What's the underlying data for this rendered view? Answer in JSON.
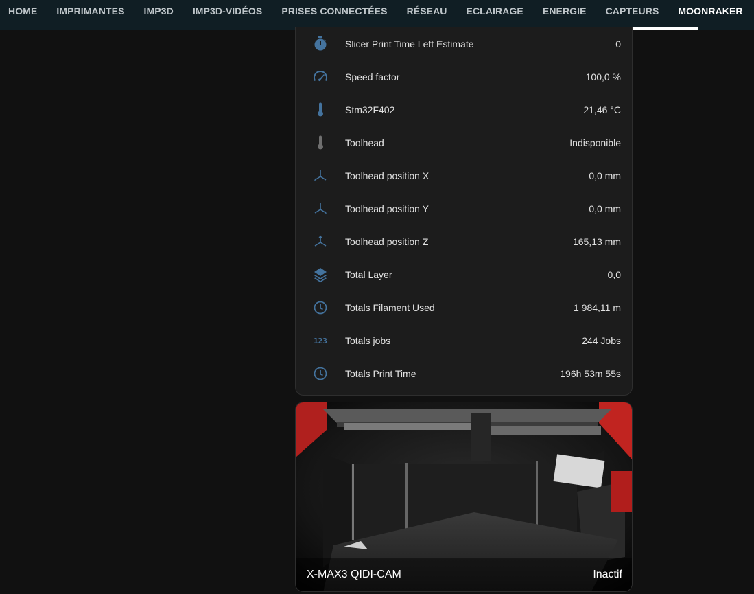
{
  "tabs": [
    {
      "label": "HOME"
    },
    {
      "label": "IMPRIMANTES"
    },
    {
      "label": "IMP3D"
    },
    {
      "label": "IMP3D-VIDÉOS"
    },
    {
      "label": "PRISES CONNECTÉES"
    },
    {
      "label": "RÉSEAU"
    },
    {
      "label": "ECLAIRAGE"
    },
    {
      "label": "ENERGIE"
    },
    {
      "label": "CAPTEURS"
    },
    {
      "label": "MOONRAKER",
      "active": true
    }
  ],
  "entities": [
    {
      "name": "Slicer Print Time Left Estimate",
      "value": "0",
      "icon": "timer-icon"
    },
    {
      "name": "Speed factor",
      "value": "100,0 %",
      "icon": "speedometer-icon"
    },
    {
      "name": "Stm32F402",
      "value": "21,46 °C",
      "icon": "thermometer-icon"
    },
    {
      "name": "Toolhead",
      "value": "Indisponible",
      "icon": "thermometer-icon"
    },
    {
      "name": "Toolhead position X",
      "value": "0,0 mm",
      "icon": "axis-x-icon"
    },
    {
      "name": "Toolhead position Y",
      "value": "0,0 mm",
      "icon": "axis-y-icon"
    },
    {
      "name": "Toolhead position Z",
      "value": "165,13 mm",
      "icon": "axis-z-icon"
    },
    {
      "name": "Total Layer",
      "value": "0,0",
      "icon": "layers-icon"
    },
    {
      "name": "Totals Filament Used",
      "value": "1 984,11 m",
      "icon": "clock-icon"
    },
    {
      "name": "Totals jobs",
      "value": "244 Jobs",
      "icon": "numeric-icon",
      "icon_text": "123"
    },
    {
      "name": "Totals Print Time",
      "value": "196h 53m 55s",
      "icon": "clock-icon"
    }
  ],
  "camera": {
    "title": "X-MAX3 QIDI-CAM",
    "state": "Inactif"
  },
  "colors": {
    "icon_active": "#44739e",
    "icon_unavailable": "#6f6f6f",
    "tabbar_bg": "#101e24",
    "card_bg": "#1c1c1c",
    "page_bg": "#111111"
  }
}
